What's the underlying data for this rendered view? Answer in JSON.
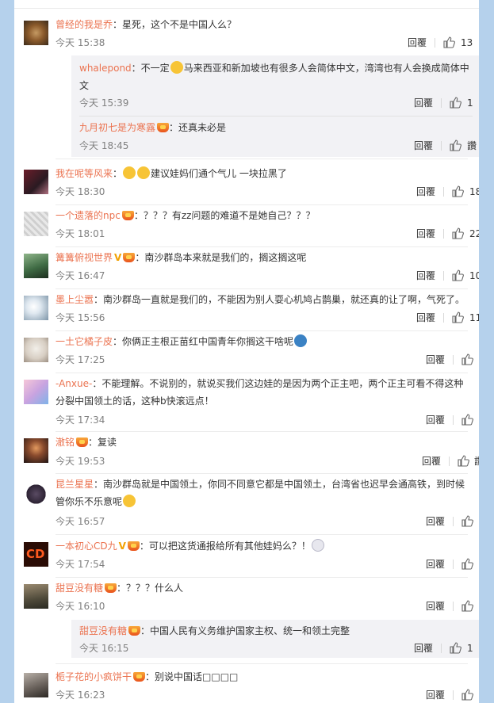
{
  "reply_label": "回覆",
  "comments": [
    {
      "name": "曾经的我是乔",
      "badge": false,
      "vip": false,
      "text": "：星死，这个不是中国人么？",
      "time": "今天 15:38",
      "likes": "13",
      "replies": [
        {
          "name": "whalepond",
          "badge": false,
          "text": "：不一定",
          "emoji": "laugh-cry",
          "text2": "马来西亚和新加坡也有很多人会简体中文，湾湾也有人会换成简体中文",
          "time": "今天 15:39",
          "likes": "1"
        },
        {
          "name": "九月初七是为寒露",
          "badge": true,
          "text": "：还真未必是",
          "time": "今天 18:45",
          "likes": "讚"
        }
      ]
    },
    {
      "name": "我在呢等风来",
      "badge": false,
      "vip": false,
      "text": "：",
      "text2": "建议娃妈们通个气儿 一块拉黑了",
      "time": "今天 18:30",
      "likes": "18"
    },
    {
      "name": "一个遗落的npc",
      "badge": true,
      "vip": false,
      "text": "：？？？有zz问题的难道不是她自己？？？",
      "time": "今天 18:01",
      "likes": "22"
    },
    {
      "name": "篝篝俯视世界",
      "badge": true,
      "vip": true,
      "text": "：南沙群岛本来就是我们的，搁这搁这呢",
      "time": "今天 16:47",
      "likes": "10"
    },
    {
      "name": "墨上尘嚣",
      "badge": false,
      "vip": false,
      "text": "：南沙群岛一直就是我们的，不能因为别人耍心机鸠占鹊巢，就还真的让了啊，气死了。",
      "time": "今天 15:56",
      "likes": "11"
    },
    {
      "name": "一土它橘子皮",
      "badge": false,
      "vip": false,
      "text": "：你俩正主根正苗红中国青年你搁这干啥呢",
      "time": "今天 17:25",
      "likes": "9"
    },
    {
      "name": "-Anxue-",
      "badge": false,
      "vip": false,
      "text": "：不能理解。不说别的，就说买我们这边娃的是因为两个正主吧，两个正主可看不得这种分裂中国领土的话，这种b快滚远点！",
      "time": "今天 17:34",
      "likes": "9"
    },
    {
      "name": "澈铭",
      "badge": true,
      "vip": false,
      "text": "：复读",
      "time": "今天 19:53",
      "likes": "讚"
    },
    {
      "name": "昆兰星星",
      "badge": false,
      "vip": false,
      "text": "：南沙群岛就是中国领土，你同不同意它都是中国领土，台湾省也迟早会通高铁，到时候管你乐不乐意呢",
      "time": "今天 16:57",
      "likes": "6"
    },
    {
      "name": "一本初心CD九",
      "badge": true,
      "vip": true,
      "text": "：可以把这货通报给所有其他娃妈么？！",
      "time": "今天 17:54",
      "likes": "6"
    },
    {
      "name": "甜豆没有糖",
      "badge": true,
      "vip": false,
      "text": "：？？？什么人",
      "time": "今天 16:10",
      "likes": "1",
      "replies": [
        {
          "name": "甜豆没有糖",
          "badge": true,
          "text": "：中国人民有义务维护国家主权、统一和领土完整",
          "time": "今天 16:15",
          "likes": "1"
        }
      ]
    },
    {
      "name": "栀子花的小疯饼干",
      "badge": true,
      "vip": false,
      "text": "：别说中国话□□□□",
      "time": "今天 16:23",
      "likes": "4"
    }
  ]
}
